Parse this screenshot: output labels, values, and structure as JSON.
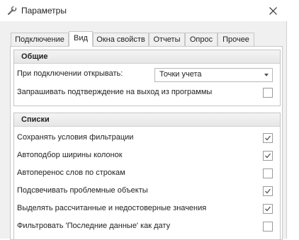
{
  "window": {
    "title": "Параметры"
  },
  "tabs": [
    {
      "label": "Подключение"
    },
    {
      "label": "Вид"
    },
    {
      "label": "Окна свойств"
    },
    {
      "label": "Отчеты"
    },
    {
      "label": "Опрос"
    },
    {
      "label": "Прочее"
    }
  ],
  "active_tab": "Вид",
  "general": {
    "header": "Общие",
    "open_on_connect_label": "При подключении открывать:",
    "open_on_connect_value": "Точки учета",
    "confirm_exit_label": "Запрашивать подтверждение на выход из программы",
    "confirm_exit_checked": false
  },
  "lists": {
    "header": "Списки",
    "items": [
      {
        "label": "Сохранять условия фильтрации",
        "checked": true
      },
      {
        "label": "Автоподбор ширины колонок",
        "checked": true
      },
      {
        "label": "Автоперенос слов по строкам",
        "checked": false
      },
      {
        "label": "Подсвечивать проблемные объекты",
        "checked": true
      },
      {
        "label": "Выделять рассчитанные и недостоверные  значения",
        "checked": true
      },
      {
        "label": "Фильтровать 'Последние данные' как дату",
        "checked": false
      }
    ]
  },
  "icons": {
    "title": "wrench-icon",
    "close": "close-icon",
    "checkbox": "checkmark-icon",
    "dropdown": "chevron-down-icon"
  }
}
